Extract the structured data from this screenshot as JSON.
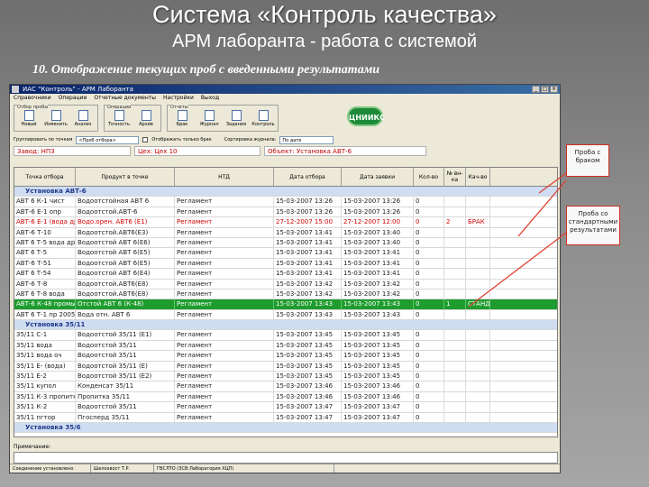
{
  "slide": {
    "title": "Система «Контроль качества»",
    "subtitle": "АРМ лаборанта - работа с системой",
    "caption": "10. Отображение текущих проб с введенными результатами"
  },
  "window": {
    "title": "ИАС \"Контроль\" - АРМ Лаборанта",
    "menu": [
      "Справочники",
      "Операции",
      "Отчетные документы",
      "Настройки",
      "Выход"
    ]
  },
  "toolbar": {
    "group1_label": "Отбор пробы",
    "group2_label": "Операции",
    "group3_label": "Отчеты",
    "buttons": [
      "Новый",
      "Изменить",
      "Анализ",
      "Точность",
      "Архив",
      "Брак",
      "Журнал",
      "Задания",
      "Контроль"
    ],
    "logo": "ЦНИИКС"
  },
  "filters": {
    "group_label": "Группировать по точкам",
    "group_value": "<Проб отбора>",
    "show_label": "Отображать только брак",
    "order_label": "Сортировка журнала:",
    "order_value": "По дате"
  },
  "info": {
    "plant": "Завод: НПЗ",
    "shop": "Цех: Цех 10",
    "unit": "Объект: Установка АВТ-6"
  },
  "table": {
    "headers": [
      "Точка отбора",
      "Продукт в точке",
      "НТД",
      "Дата отбора",
      "Дата заявки",
      "Кол-во",
      "№ вн-ка",
      "Кач-во"
    ],
    "rows": [
      {
        "type": "group",
        "cells": [
          "Установка АВТ-6"
        ]
      },
      {
        "type": "normal",
        "cells": [
          "АВТ 6 К-1 чист",
          "Водоотстойная АВТ 6",
          "Регламент",
          "15-03-2007 13:26",
          "15-03-2007 13:26",
          "0",
          "",
          ""
        ]
      },
      {
        "type": "normal",
        "cells": [
          "АВТ-6 Е-1 опр",
          "Водоотстой.АВТ-6",
          "Регламент",
          "15-03-2007 13:26",
          "15-03-2007 13:26",
          "0",
          "",
          ""
        ]
      },
      {
        "type": "defect",
        "cells": [
          "АВТ-6 Е-1 (вода др.",
          "Водо.орен. АВТ6 (Е1)",
          "Регламент",
          "27-12-2007 15:00",
          "27-12-2007 12:00",
          "0",
          "2",
          "БРАК"
        ]
      },
      {
        "type": "normal",
        "cells": [
          "АВТ-6 Т-10",
          "Водоотстой.АВТ6(Е3)",
          "Регламент",
          "15-03-2007 13:41",
          "15-03-2007 13:40",
          "0",
          "",
          ""
        ]
      },
      {
        "type": "normal",
        "cells": [
          "АВТ 6 Т-5 вода др",
          "Водоотстой АВТ 6(Е6)",
          "Регламент",
          "15-03-2007 13:41",
          "15-03-2007 13:40",
          "0",
          "",
          ""
        ]
      },
      {
        "type": "normal",
        "cells": [
          "АВТ 6 Т-5",
          "Водоотстой АВТ 6(Е5)",
          "Регламент",
          "15-03-2007 13:41",
          "15-03-2007 13:41",
          "0",
          "",
          ""
        ]
      },
      {
        "type": "normal",
        "cells": [
          "АВТ-6 Т-51",
          "Водоотстой АВТ 6(Е5)",
          "Регламент",
          "15-03-2007 13:41",
          "15-03-2007 13:41",
          "0",
          "",
          ""
        ]
      },
      {
        "type": "normal",
        "cells": [
          "АВТ 6 Т-54",
          "Водоотстой АВТ 6(Е4)",
          "Регламент",
          "15-03-2007 13:41",
          "15-03-2007 13:41",
          "0",
          "",
          ""
        ]
      },
      {
        "type": "normal",
        "cells": [
          "АВТ-6 Т-8",
          "Водоотстой.АВТ6(Е8)",
          "Регламент",
          "15-03-2007 13:42",
          "15-03-2007 13:42",
          "0",
          "",
          ""
        ]
      },
      {
        "type": "normal",
        "cells": [
          "АВТ 6 Т-8 вода",
          "Водоотстой.АВТ6(Е8)",
          "Регламент",
          "15-03-2007 13:42",
          "15-03-2007 13:42",
          "0",
          "",
          ""
        ]
      },
      {
        "type": "selected",
        "cells": [
          "АВТ-6 К-48 промыт",
          "Отстой АВТ 6 (К-48)",
          "Регламент",
          "15-03-2007 13:43",
          "15-03-2007 13:43",
          "0",
          "1",
          "СТАНД"
        ]
      },
      {
        "type": "normal",
        "cells": [
          "АВТ 6 Т-1 пр 2005",
          "Вода отн. АВТ 6",
          "Регламент",
          "15-03-2007 13:43",
          "15-03-2007 13:43",
          "0",
          "",
          ""
        ]
      },
      {
        "type": "group",
        "cells": [
          "Установка 35/11"
        ]
      },
      {
        "type": "normal",
        "cells": [
          "35/11 С-1",
          "Водоотстой 35/11 (Е1)",
          "Регламент",
          "15-03-2007 13:45",
          "15-03-2007 13:45",
          "0",
          "",
          ""
        ]
      },
      {
        "type": "normal",
        "cells": [
          "35/11 вода",
          "Водоотстой 35/11",
          "Регламент",
          "15-03-2007 13:45",
          "15-03-2007 13:45",
          "0",
          "",
          ""
        ]
      },
      {
        "type": "normal",
        "cells": [
          "35/11 вода оч",
          "Водоотстой 35/11",
          "Регламент",
          "15-03-2007 13:45",
          "15-03-2007 13:45",
          "0",
          "",
          ""
        ]
      },
      {
        "type": "normal",
        "cells": [
          "35/11 Е- (вода)",
          "Водоотстой 35/11 (Е)",
          "Регламент",
          "15-03-2007 13:45",
          "15-03-2007 13:45",
          "0",
          "",
          ""
        ]
      },
      {
        "type": "normal",
        "cells": [
          "35/11 Е-2",
          "Водоотстой 35/11 (Е2)",
          "Регламент",
          "15-03-2007 13:45",
          "15-03-2007 13:45",
          "0",
          "",
          ""
        ]
      },
      {
        "type": "normal",
        "cells": [
          "35/11 купол",
          "Конденсат 35/11",
          "Регламент",
          "15-03-2007 13:46",
          "15-03-2007 13:46",
          "0",
          "",
          ""
        ]
      },
      {
        "type": "normal",
        "cells": [
          "35/11 К-3 пропитка",
          "Пропитка 35/11",
          "Регламент",
          "15-03-2007 13:46",
          "15-03-2007 13:46",
          "0",
          "",
          ""
        ]
      },
      {
        "type": "normal",
        "cells": [
          "35/11 К-2",
          "Водоотстой 35/11",
          "Регламент",
          "15-03-2007 13:47",
          "15-03-2007 13:47",
          "0",
          "",
          ""
        ]
      },
      {
        "type": "normal",
        "cells": [
          "35/11 пгтор",
          "Пгосперд 35/11",
          "Регламент",
          "15-03-2007 13:47",
          "15-03-2007 13:47",
          "0",
          "",
          ""
        ]
      },
      {
        "type": "group",
        "cells": [
          "Установка 35/6"
        ]
      }
    ]
  },
  "remark_label": "Примечание:",
  "status": [
    "Соединение установлено",
    "Шелохвост Т.Р.",
    "ГВСЛТО (ЗСВ:Лаборатория ХЦП)"
  ],
  "callouts": {
    "defect": "Проба с браком",
    "standard": "Проба со стандартными результатами"
  },
  "colors": {
    "selected_row": "#1e9c2e",
    "defect_text": "#d00000",
    "group_row": "#cfdcf2",
    "callout_line": "#e04030"
  }
}
